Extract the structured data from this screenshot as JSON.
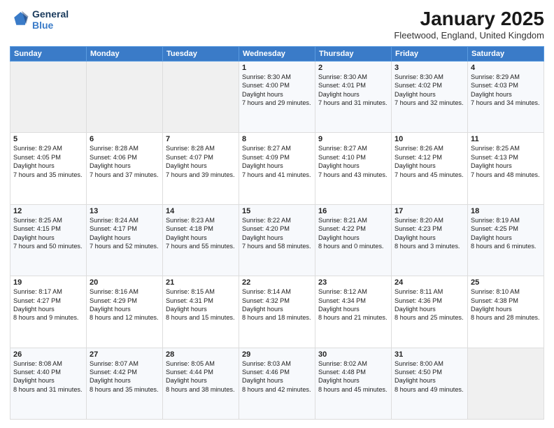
{
  "header": {
    "logo_line1": "General",
    "logo_line2": "Blue",
    "month": "January 2025",
    "location": "Fleetwood, England, United Kingdom"
  },
  "days_of_week": [
    "Sunday",
    "Monday",
    "Tuesday",
    "Wednesday",
    "Thursday",
    "Friday",
    "Saturday"
  ],
  "weeks": [
    [
      {
        "day": "",
        "empty": true
      },
      {
        "day": "",
        "empty": true
      },
      {
        "day": "",
        "empty": true
      },
      {
        "day": "1",
        "sunrise": "8:30 AM",
        "sunset": "4:00 PM",
        "daylight": "7 hours and 29 minutes."
      },
      {
        "day": "2",
        "sunrise": "8:30 AM",
        "sunset": "4:01 PM",
        "daylight": "7 hours and 31 minutes."
      },
      {
        "day": "3",
        "sunrise": "8:30 AM",
        "sunset": "4:02 PM",
        "daylight": "7 hours and 32 minutes."
      },
      {
        "day": "4",
        "sunrise": "8:29 AM",
        "sunset": "4:03 PM",
        "daylight": "7 hours and 34 minutes."
      }
    ],
    [
      {
        "day": "5",
        "sunrise": "8:29 AM",
        "sunset": "4:05 PM",
        "daylight": "7 hours and 35 minutes."
      },
      {
        "day": "6",
        "sunrise": "8:28 AM",
        "sunset": "4:06 PM",
        "daylight": "7 hours and 37 minutes."
      },
      {
        "day": "7",
        "sunrise": "8:28 AM",
        "sunset": "4:07 PM",
        "daylight": "7 hours and 39 minutes."
      },
      {
        "day": "8",
        "sunrise": "8:27 AM",
        "sunset": "4:09 PM",
        "daylight": "7 hours and 41 minutes."
      },
      {
        "day": "9",
        "sunrise": "8:27 AM",
        "sunset": "4:10 PM",
        "daylight": "7 hours and 43 minutes."
      },
      {
        "day": "10",
        "sunrise": "8:26 AM",
        "sunset": "4:12 PM",
        "daylight": "7 hours and 45 minutes."
      },
      {
        "day": "11",
        "sunrise": "8:25 AM",
        "sunset": "4:13 PM",
        "daylight": "7 hours and 48 minutes."
      }
    ],
    [
      {
        "day": "12",
        "sunrise": "8:25 AM",
        "sunset": "4:15 PM",
        "daylight": "7 hours and 50 minutes."
      },
      {
        "day": "13",
        "sunrise": "8:24 AM",
        "sunset": "4:17 PM",
        "daylight": "7 hours and 52 minutes."
      },
      {
        "day": "14",
        "sunrise": "8:23 AM",
        "sunset": "4:18 PM",
        "daylight": "7 hours and 55 minutes."
      },
      {
        "day": "15",
        "sunrise": "8:22 AM",
        "sunset": "4:20 PM",
        "daylight": "7 hours and 58 minutes."
      },
      {
        "day": "16",
        "sunrise": "8:21 AM",
        "sunset": "4:22 PM",
        "daylight": "8 hours and 0 minutes."
      },
      {
        "day": "17",
        "sunrise": "8:20 AM",
        "sunset": "4:23 PM",
        "daylight": "8 hours and 3 minutes."
      },
      {
        "day": "18",
        "sunrise": "8:19 AM",
        "sunset": "4:25 PM",
        "daylight": "8 hours and 6 minutes."
      }
    ],
    [
      {
        "day": "19",
        "sunrise": "8:17 AM",
        "sunset": "4:27 PM",
        "daylight": "8 hours and 9 minutes."
      },
      {
        "day": "20",
        "sunrise": "8:16 AM",
        "sunset": "4:29 PM",
        "daylight": "8 hours and 12 minutes."
      },
      {
        "day": "21",
        "sunrise": "8:15 AM",
        "sunset": "4:31 PM",
        "daylight": "8 hours and 15 minutes."
      },
      {
        "day": "22",
        "sunrise": "8:14 AM",
        "sunset": "4:32 PM",
        "daylight": "8 hours and 18 minutes."
      },
      {
        "day": "23",
        "sunrise": "8:12 AM",
        "sunset": "4:34 PM",
        "daylight": "8 hours and 21 minutes."
      },
      {
        "day": "24",
        "sunrise": "8:11 AM",
        "sunset": "4:36 PM",
        "daylight": "8 hours and 25 minutes."
      },
      {
        "day": "25",
        "sunrise": "8:10 AM",
        "sunset": "4:38 PM",
        "daylight": "8 hours and 28 minutes."
      }
    ],
    [
      {
        "day": "26",
        "sunrise": "8:08 AM",
        "sunset": "4:40 PM",
        "daylight": "8 hours and 31 minutes."
      },
      {
        "day": "27",
        "sunrise": "8:07 AM",
        "sunset": "4:42 PM",
        "daylight": "8 hours and 35 minutes."
      },
      {
        "day": "28",
        "sunrise": "8:05 AM",
        "sunset": "4:44 PM",
        "daylight": "8 hours and 38 minutes."
      },
      {
        "day": "29",
        "sunrise": "8:03 AM",
        "sunset": "4:46 PM",
        "daylight": "8 hours and 42 minutes."
      },
      {
        "day": "30",
        "sunrise": "8:02 AM",
        "sunset": "4:48 PM",
        "daylight": "8 hours and 45 minutes."
      },
      {
        "day": "31",
        "sunrise": "8:00 AM",
        "sunset": "4:50 PM",
        "daylight": "8 hours and 49 minutes."
      },
      {
        "day": "",
        "empty": true
      }
    ]
  ]
}
